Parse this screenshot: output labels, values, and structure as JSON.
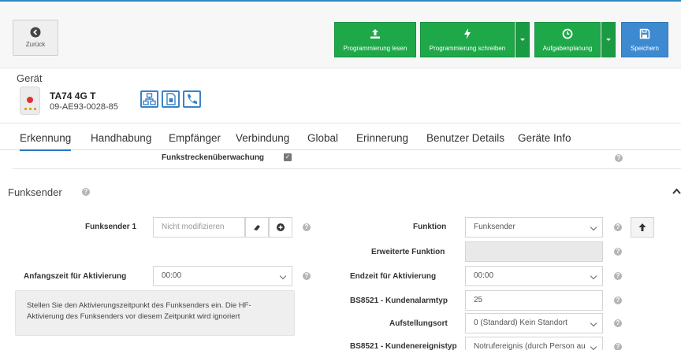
{
  "toolbar": {
    "back_label": "Zurück",
    "read_label": "Programmierung lesen",
    "write_label": "Programmierung schreiben",
    "tasks_label": "Aufgabenplanung",
    "save_label": "Speichern"
  },
  "device": {
    "section_label": "Gerät",
    "name": "TA74 4G T",
    "serial": "09-AE93-0028-85"
  },
  "tabs": [
    "Erkennung",
    "Handhabung",
    "Empfänger",
    "Verbindung",
    "Global",
    "Erinnerung",
    "Benutzer Details",
    "Geräte Info"
  ],
  "top_row": {
    "label": "Funkstreckenüberwachung",
    "checked": true
  },
  "section": {
    "title": "Funksender",
    "funksender1": {
      "label": "Funksender 1",
      "placeholder": "Nicht modifizieren"
    },
    "funktion": {
      "label": "Funktion",
      "value": "Funksender"
    },
    "erweiterte": {
      "label": "Erweiterte Funktion",
      "value": ""
    },
    "anfang": {
      "label": "Anfangszeit für Aktivierung",
      "value": "00:00"
    },
    "endzeit": {
      "label": "Endzeit für Aktivierung",
      "value": "00:00"
    },
    "kundenalarm": {
      "label": "BS8521 - Kundenalarmtyp",
      "value": "25"
    },
    "aufstellung": {
      "label": "Aufstellungsort",
      "value": "0 (Standard) Kein Standort"
    },
    "kundenereignis": {
      "label": "BS8521 - Kundenereignistyp",
      "value": "Notrufereignis (durch Person au"
    },
    "hint": "Stellen Sie den Aktivierungszeitpunkt des Funksenders ein. Die HF-Aktivierung des Funksenders vor diesem Zeitpunkt wird ignoriert"
  },
  "colors": {
    "green": "#1fa84a",
    "blue": "#3d8ad1",
    "tab_active": "#2b78c2"
  }
}
